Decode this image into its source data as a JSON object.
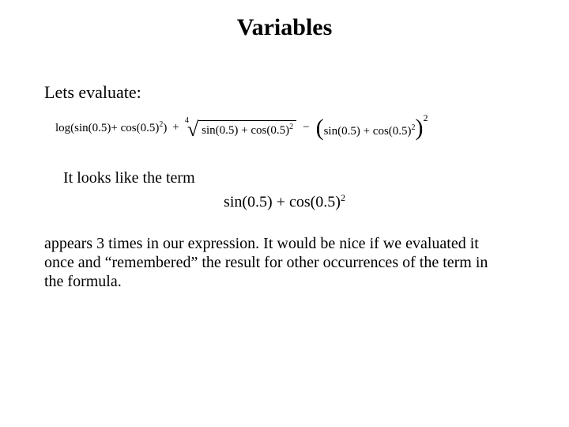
{
  "title": "Variables",
  "lead": "Lets evaluate:",
  "formula": {
    "log_label": "log",
    "arg1": "sin(0.5)",
    "plus": "+",
    "arg2_base": "cos(0.5)",
    "arg2_exp": "2",
    "root_index": "4",
    "radicand_a": "sin(0.5)",
    "radicand_b_base": "cos(0.5)",
    "radicand_b_exp": "2",
    "minus": "−",
    "third_a": "sin(0.5)",
    "third_b_base": "cos(0.5)",
    "third_b_exp": "2",
    "outer_exp": "2"
  },
  "looks_like": "It looks like the term",
  "term": {
    "a": "sin(0.5)",
    "plus": "+",
    "b_base": "cos(0.5)",
    "b_exp": "2"
  },
  "paragraph": "appears 3 times in our expression. It would be nice if we evaluated it once and “remembered” the result for other occurrences of the term in the formula."
}
